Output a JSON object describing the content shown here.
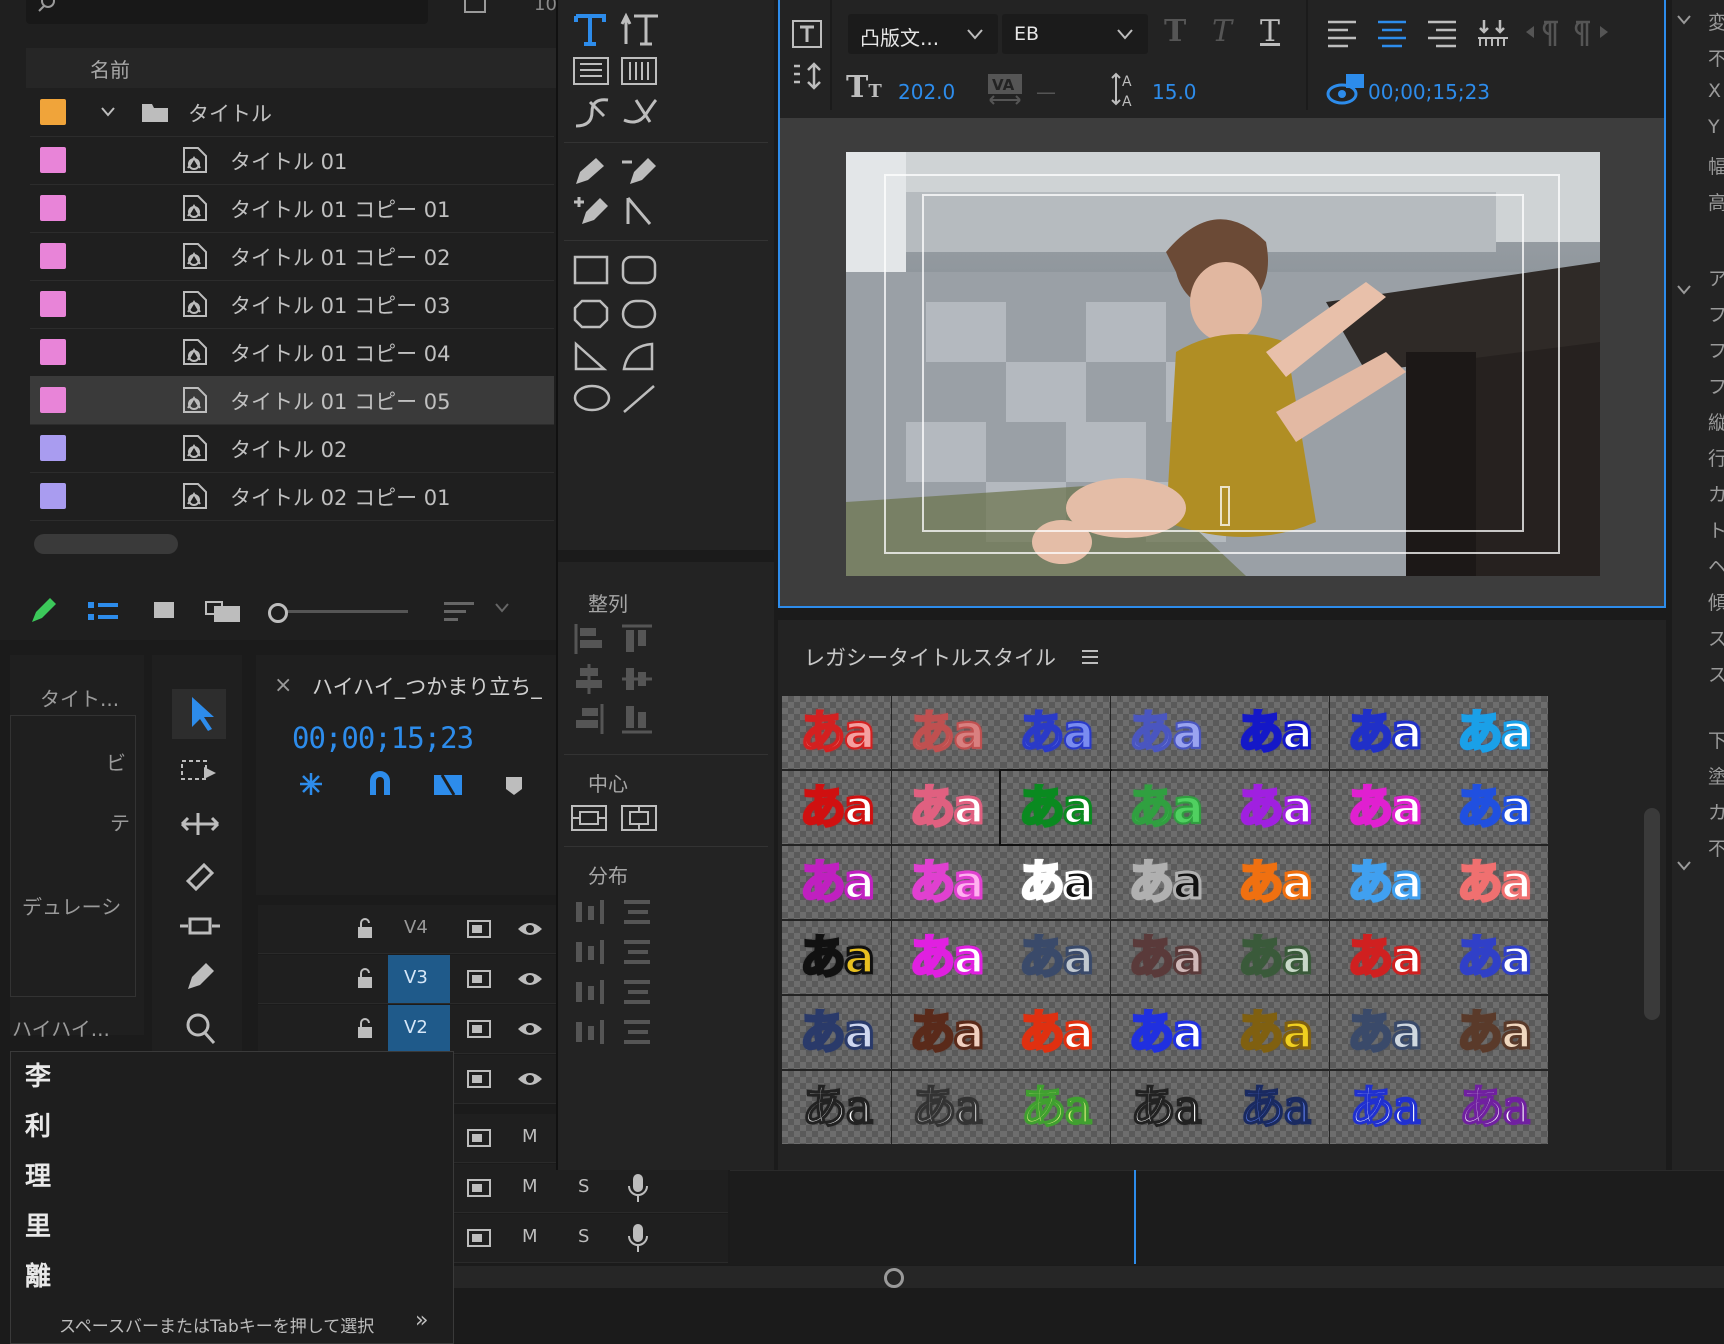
{
  "project": {
    "column_name": "名前",
    "items": [
      {
        "label": "タイトル",
        "color": "#f0a43a",
        "type": "folder"
      },
      {
        "label": "タイトル 01",
        "color": "#e884d8",
        "type": "title"
      },
      {
        "label": "タイトル 01 コピー 01",
        "color": "#e884d8",
        "type": "title"
      },
      {
        "label": "タイトル 01 コピー 02",
        "color": "#e884d8",
        "type": "title"
      },
      {
        "label": "タイトル 01 コピー 03",
        "color": "#e884d8",
        "type": "title"
      },
      {
        "label": "タイトル 01 コピー 04",
        "color": "#e884d8",
        "type": "title"
      },
      {
        "label": "タイトル 01 コピー 05",
        "color": "#e884d8",
        "type": "title",
        "selected": true
      },
      {
        "label": "タイトル 02",
        "color": "#a99cf0",
        "type": "title"
      },
      {
        "label": "タイトル 02 コピー 01",
        "color": "#a99cf0",
        "type": "title"
      }
    ]
  },
  "effect_panel": {
    "tab_label": "タイト...",
    "line2": "ビ",
    "line3": "テ",
    "duration_label": "デュレーシ",
    "bottom_label": "ハイハイ..."
  },
  "timeline": {
    "sequence_name": "ハイハイ_つかまり立ち_",
    "timecode": "00;00;15;23",
    "tracks": [
      {
        "name": "V4",
        "active": false
      },
      {
        "name": "V3",
        "active": true
      },
      {
        "name": "V2",
        "active": true
      }
    ],
    "audio_m": "M",
    "audio_s": "S"
  },
  "title_tools": {
    "align_label": "整列",
    "center_label": "中心",
    "distribute_label": "分布"
  },
  "title_toolbar": {
    "font_family": "凸版文...",
    "font_style": "EB",
    "font_size": "202.0",
    "kerning": "—",
    "leading": "15.0",
    "timecode": "00;00;15;23"
  },
  "styles_panel": {
    "title": "レガシータイトルスタイル",
    "sample": "あa"
  },
  "right_panel_glyphs": [
    "変",
    "不",
    "X",
    "Y",
    "幅",
    "高",
    "ア",
    "フ",
    "フ",
    "フ",
    "縦",
    "行",
    "カ",
    "ト",
    "ヘ",
    "傾",
    "ス",
    "ス",
    "下",
    "塗",
    "カ",
    "不"
  ],
  "ime": {
    "candidates": [
      "李",
      "利",
      "理",
      "里",
      "離"
    ],
    "hint": "スペースバーまたはTabキーを押して選択",
    "hint_arrow": "»"
  },
  "colors": {
    "accent_blue": "#2d8ceb",
    "track_active": "#1f5a8a",
    "selection_row": "#3a3a3a"
  }
}
